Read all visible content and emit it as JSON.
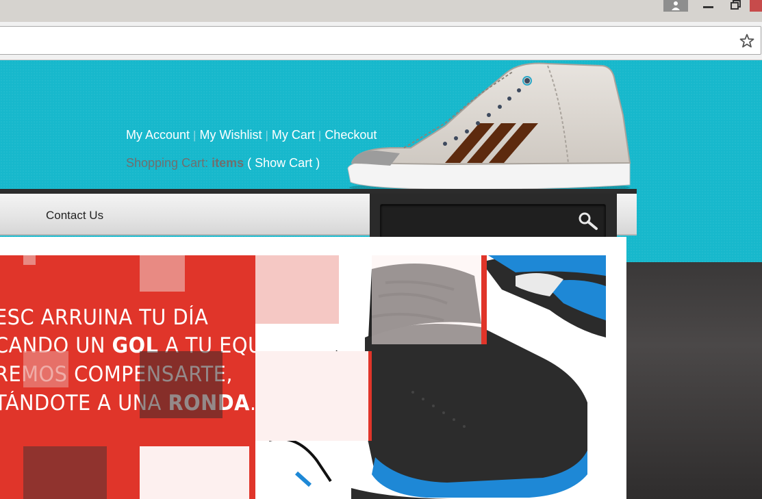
{
  "browser": {
    "icons": [
      "user-icon",
      "minimize-icon",
      "restore-icon",
      "close-icon",
      "star-icon"
    ],
    "address": ""
  },
  "header": {
    "links": [
      "My Account",
      "My Wishlist",
      "My Cart",
      "Checkout"
    ],
    "cart": {
      "prefix": "Shopping Cart:",
      "items": "items",
      "open_paren": "(",
      "show_cart": "Show Cart",
      "close_paren": ")"
    }
  },
  "nav": {
    "items": [
      "Contact Us"
    ]
  },
  "search": {
    "placeholder": "",
    "icon": "search-icon"
  },
  "banner": {
    "lines": [
      {
        "pre": "ESC ARRUINA TU DÍA",
        "bold": "",
        "post": ""
      },
      {
        "pre": "CANDO UN ",
        "bold": "GOL",
        "post": " A TU EQUIPO,"
      },
      {
        "pre": "REMOS COMPENSARTE,",
        "bold": "",
        "post": ""
      },
      {
        "pre": "TÁNDOTE A UNA ",
        "bold": "RONDA",
        "post": "."
      }
    ]
  },
  "colors": {
    "teal": "#17b8cc",
    "banner_red": "#e0352a",
    "shoe_blue": "#1e88d6"
  }
}
